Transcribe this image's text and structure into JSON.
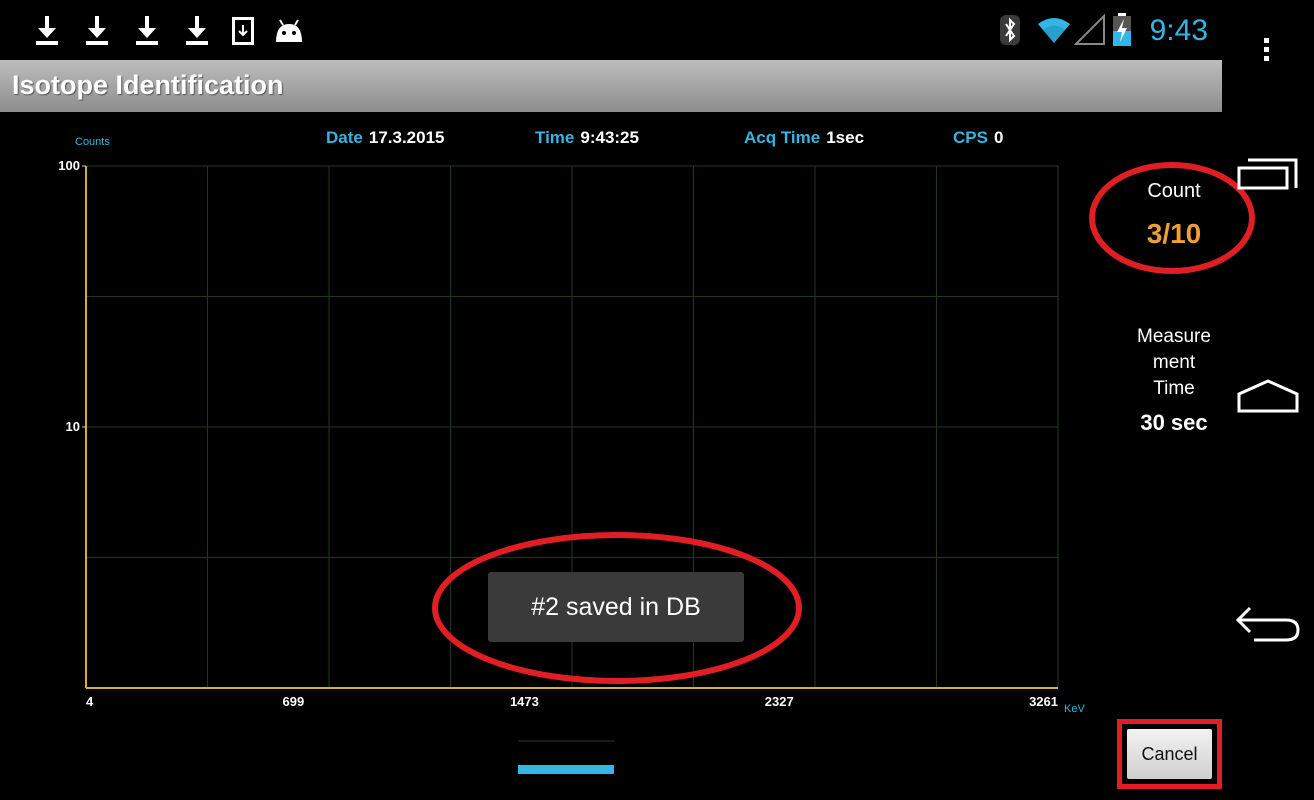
{
  "status_bar": {
    "notifications": [
      "download-icon",
      "download-icon",
      "download-icon",
      "download-icon",
      "download-file-icon",
      "android-icon"
    ],
    "system_icons": [
      "bluetooth-icon",
      "wifi-icon",
      "signal-icon",
      "battery-charging-icon"
    ],
    "clock": "9:43",
    "accent_color": "#33b5e5"
  },
  "app": {
    "title": "Isotope Identification"
  },
  "info": {
    "date_label": "Date",
    "date_value": "17.3.2015",
    "time_label": "Time",
    "time_value": "9:43:25",
    "acq_label": "Acq Time",
    "acq_value": "1sec",
    "cps_label": "CPS",
    "cps_value": "0"
  },
  "chart_data": {
    "type": "line",
    "ylabel": "Counts",
    "xlabel": "KeV",
    "y_scale": "log",
    "ylim": [
      1,
      100
    ],
    "xlim": [
      4,
      3261
    ],
    "y_ticks": [
      "100",
      "10"
    ],
    "x_ticks": [
      "4",
      "699",
      "1473",
      "2327",
      "3261"
    ],
    "grid": true,
    "series": [],
    "baseline_color": "#d4b030",
    "grid_color": "#1f3a1f"
  },
  "side_panel": {
    "count_label": "Count",
    "count_value": "3/10",
    "count_color": "#f0a030",
    "measurement_label_lines": [
      "Measure",
      "ment",
      "Time"
    ],
    "measurement_value": "30 sec"
  },
  "toast": {
    "message": "#2 saved in DB"
  },
  "buttons": {
    "cancel": "Cancel"
  },
  "nav_bar": {
    "icons": [
      "overflow-menu-icon",
      "recent-apps-icon",
      "home-icon",
      "back-icon"
    ]
  },
  "annotation_color": "#e01e24"
}
